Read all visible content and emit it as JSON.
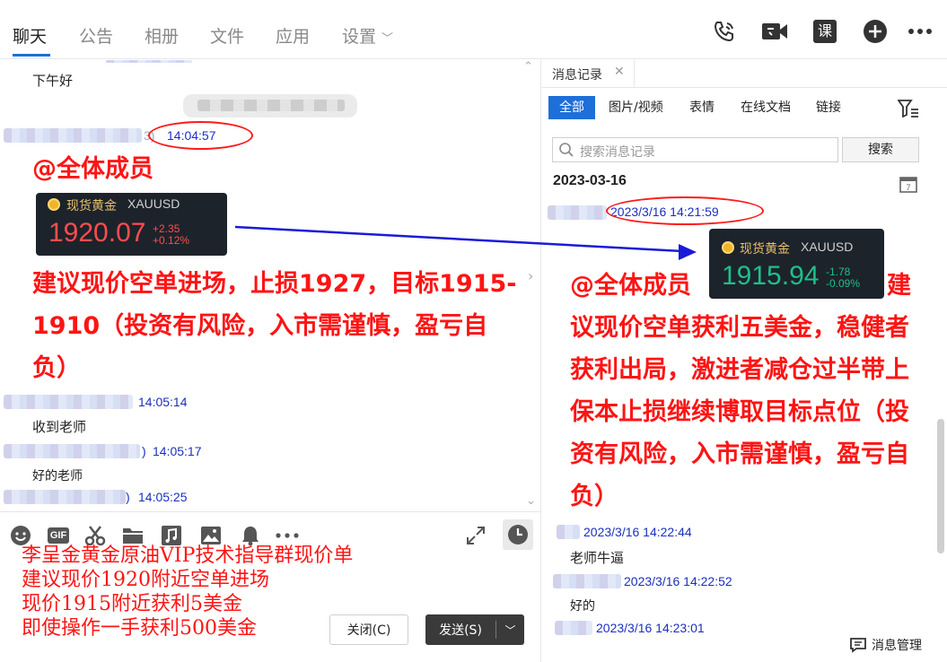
{
  "nav": {
    "tabs": [
      "聊天",
      "公告",
      "相册",
      "文件",
      "应用",
      "设置"
    ],
    "active_tab": "聊天",
    "top_icons": [
      "phone-icon",
      "video-call-icon",
      "class-icon",
      "add-circle-icon",
      "more-icon"
    ],
    "class_icon_label": "课"
  },
  "chat": {
    "greeting": "下午好",
    "time_1": "14:04:57",
    "at_all": "@全体成员",
    "gold_left": {
      "name": "现货黄金",
      "symbol": "XAUUSD",
      "price": "1920.07",
      "change": "+2.35",
      "change_pct": "+0.12%"
    },
    "instruction_lines": [
      "建议现价空单进场，止损1927，目标1915-",
      "1910（投资有风险，入市需谨慎，盈亏自",
      "负）"
    ],
    "time_2": "14:05:14",
    "reply_1": "收到老师",
    "time_3": "14:05:17",
    "reply_2": "好的老师",
    "time_4": "14:05:25",
    "name_fragment_1": "3)",
    "name_fragment_2": ")",
    "name_fragment_3": ")"
  },
  "composer": {
    "tools": [
      "emoji-icon",
      "gif-icon",
      "scissors-icon",
      "folder-icon",
      "music-icon",
      "image-icon",
      "bell-icon",
      "more-icon"
    ],
    "gif_label": "GIF",
    "handwriting_lines": [
      "李呈金黄金原油VIP技术指导群现价单",
      "建议现价1920附近空单进场",
      "现价1915附近获利5美金",
      "即使操作一手获利500美金"
    ],
    "close_label": "关闭(C)",
    "send_label": "发送(S)"
  },
  "history": {
    "tab_label": "消息记录",
    "filters": [
      "全部",
      "图片/视频",
      "表情",
      "在线文档",
      "链接"
    ],
    "active_filter": "全部",
    "search_placeholder": "搜索消息记录",
    "search_button": "搜索",
    "date_header": "2023-03-16",
    "time_1": "2023/3/16 14:21:59",
    "gold_right": {
      "name": "现货黄金",
      "symbol": "XAUUSD",
      "price": "1915.94",
      "change": "-1.78",
      "change_pct": "-0.09%"
    },
    "at_all": "@全体成员",
    "text_lines": [
      "建",
      "议现价空单获利五美金，稳健者",
      "获利出局，激进者减仓过半带上",
      "保本止损继续博取目标点位（投",
      "资有风险，入市需谨慎，盈亏自",
      "负）"
    ],
    "time_2": "2023/3/16 14:22:44",
    "reply_1": "老师牛逼",
    "time_3": "2023/3/16 14:22:52",
    "reply_2": "好的",
    "time_4": "2023/3/16 14:23:01",
    "manage_label": "消息管理"
  },
  "colors": {
    "accent": "#1e6fd9",
    "annotation_red": "#ff1414",
    "timestamp_blue": "#1b2fbf",
    "gold_up": "#ff4d4f",
    "gold_down": "#1fbf8a"
  }
}
